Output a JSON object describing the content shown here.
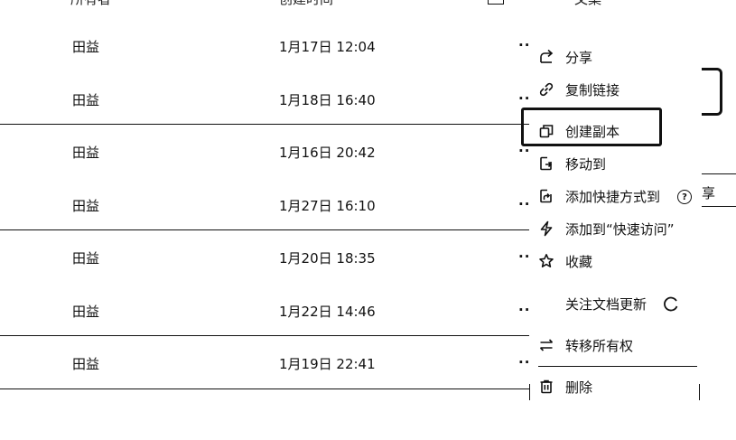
{
  "header": {
    "owner": "所有者",
    "created": "创建时间",
    "folder": "文案"
  },
  "rows": [
    {
      "owner": "田益",
      "created": "1月17日 12:04",
      "more": "··"
    },
    {
      "owner": "田益",
      "created": "1月18日 16:40",
      "more": "··"
    },
    {
      "owner": "田益",
      "created": "1月16日 20:42",
      "more": "··"
    },
    {
      "owner": "田益",
      "created": "1月27日 16:10",
      "more": "··"
    },
    {
      "owner": "田益",
      "created": "1月20日 18:35",
      "more": "··"
    },
    {
      "owner": "田益",
      "created": "1月22日 14:46",
      "more": "··"
    },
    {
      "owner": "田益",
      "created": "1月19日 22:41",
      "more": "··"
    }
  ],
  "menu": {
    "items": [
      {
        "label": "分享",
        "icon": "share-icon"
      },
      {
        "label": "复制链接",
        "icon": "link-icon"
      },
      {
        "label": "创建副本",
        "icon": "copy-icon",
        "highlighted": true
      },
      {
        "label": "移动到",
        "icon": "move-icon"
      },
      {
        "label": "添加快捷方式到",
        "icon": "shortcut-icon"
      },
      {
        "label": "添加到“快速访问”",
        "icon": "lightning-icon"
      },
      {
        "label": "收藏",
        "icon": "star-icon"
      },
      {
        "label": "关注文档更新",
        "icon": "none"
      },
      {
        "label": "转移所有权",
        "icon": "transfer-icon"
      },
      {
        "label": "删除",
        "icon": "trash-icon"
      }
    ],
    "help_glyph": "?"
  },
  "right_fragment": {
    "text": "享"
  }
}
